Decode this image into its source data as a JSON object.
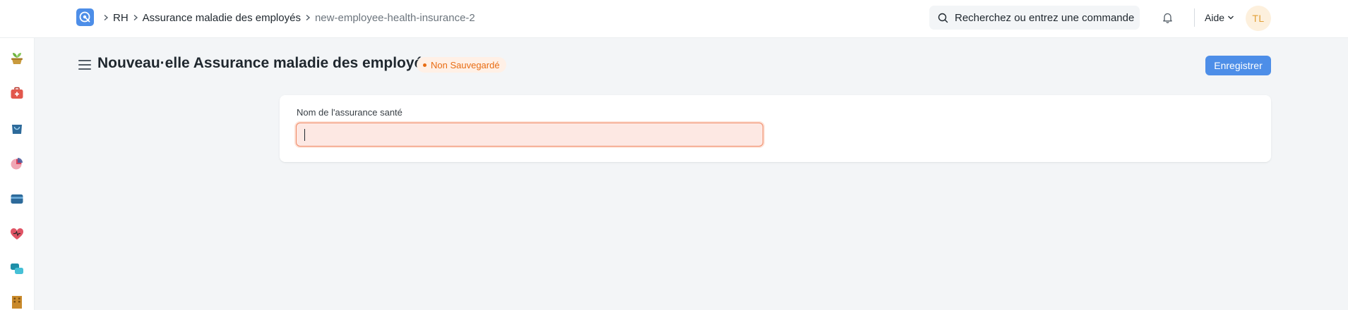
{
  "navbar": {
    "breadcrumb": [
      {
        "label": "RH"
      },
      {
        "label": "Assurance maladie des employés"
      },
      {
        "label": "new-employee-health-insurance-2"
      }
    ],
    "search_placeholder": "Recherchez ou entrez une commande",
    "help_label": "Aide",
    "avatar_initials": "TL"
  },
  "sidebar": {
    "icons": [
      "plant-icon",
      "first-aid-kit-icon",
      "bag-icon",
      "pie-chart-icon",
      "wallet-icon",
      "heart-icon",
      "chat-bubbles-icon",
      "building-icon"
    ]
  },
  "page": {
    "title": "Nouveau·elle Assurance maladie des employés",
    "status": "Non Sauvegardé",
    "save_label": "Enregistrer"
  },
  "form": {
    "field_label": "Nom de l'assurance santé",
    "field_value": ""
  },
  "colors": {
    "primary": "#4d8ee8",
    "status_orange": "#e86c13",
    "input_error_bg": "#fde8e3"
  }
}
